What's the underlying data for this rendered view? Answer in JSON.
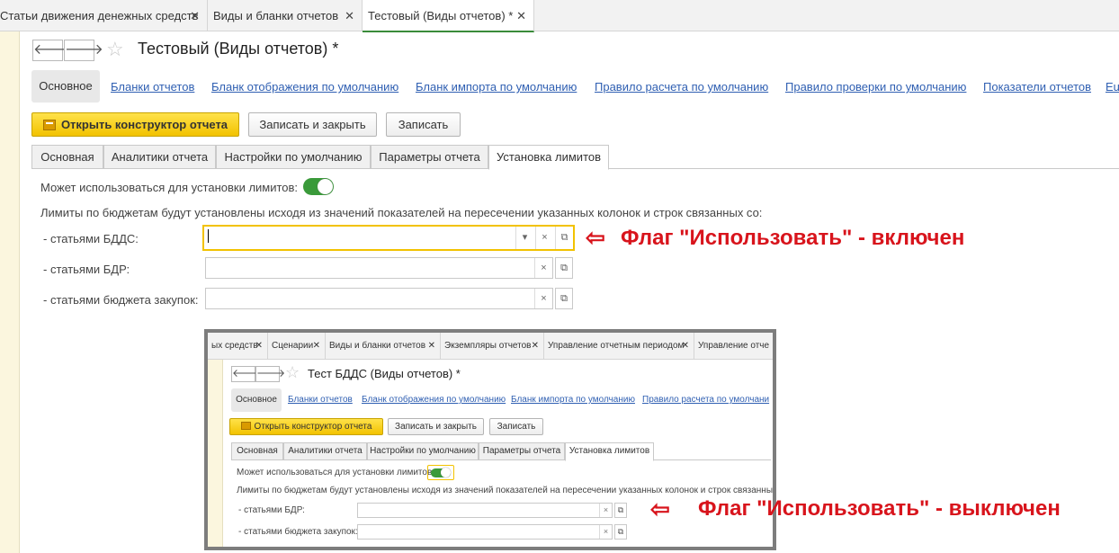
{
  "top_tabs": [
    {
      "label": "Статьи движения денежных средств",
      "close": "✕"
    },
    {
      "label": "Виды и бланки отчетов",
      "close": "✕"
    },
    {
      "label": "Тестовый (Виды отчетов) *",
      "close": "✕"
    }
  ],
  "header": {
    "back": "🡐",
    "forward": "🡒",
    "star": "☆",
    "title": "Тестовый (Виды отчетов) *"
  },
  "sections": {
    "active": "Основное",
    "links": [
      "Бланки отчетов",
      "Бланк отображения по умолчанию",
      "Бланк импорта по умолчанию",
      "Правило расчета по умолчанию",
      "Правило проверки по умолчанию",
      "Показатели отчетов",
      "Eu"
    ]
  },
  "commands": {
    "open_designer": "Открыть конструктор отчета",
    "save_close": "Записать и закрыть",
    "save": "Записать"
  },
  "form_tabs": [
    "Основная",
    "Аналитики отчета",
    "Настройки по умолчанию",
    "Параметры отчета",
    "Установка лимитов"
  ],
  "limits": {
    "toggle_label": "Может использоваться для установки лимитов:",
    "toggle_state": "on",
    "description": "Лимиты по бюджетам будут установлены исходя из значений показателей на пересечении указанных колонок и строк связанных со:",
    "fields": [
      {
        "label": "- статьями БДДС:",
        "value": ""
      },
      {
        "label": "- статьями БДР:",
        "value": ""
      },
      {
        "label": "- статьями бюджета закупок:",
        "value": ""
      }
    ],
    "dropdown_glyph": "▾",
    "clear_glyph": "×",
    "open_glyph": "⧉"
  },
  "annotations": {
    "on": "Флаг \"Использовать\" - включен",
    "off": "Флаг \"Использовать\" - выключен",
    "arrow": "⇦"
  },
  "inset": {
    "tabs": [
      "ых средств",
      "Сценарии",
      "Виды и бланки отчетов",
      "Экземпляры отчетов",
      "Управление отчетным периодом",
      "Управление отче"
    ],
    "close": "✕",
    "title": "Тест БДДС (Виды отчетов) *",
    "section_active": "Основное",
    "section_links": [
      "Бланки отчетов",
      "Бланк отображения по умолчанию",
      "Бланк импорта по умолчанию",
      "Правило расчета по умолчани"
    ],
    "commands": {
      "open_designer": "Открыть конструктор отчета",
      "save_close": "Записать и закрыть",
      "save": "Записать"
    },
    "form_tabs": [
      "Основная",
      "Аналитики отчета",
      "Настройки по умолчанию",
      "Параметры отчета",
      "Установка лимитов"
    ],
    "toggle_label": "Может использоваться для установки лимитов:",
    "description": "Лимиты по бюджетам будут установлены исходя из значений показателей на пересечении указанных колонок и строк связанных со:",
    "fields": [
      "- статьями БДР:",
      "- статьями бюджета закупок:"
    ]
  }
}
